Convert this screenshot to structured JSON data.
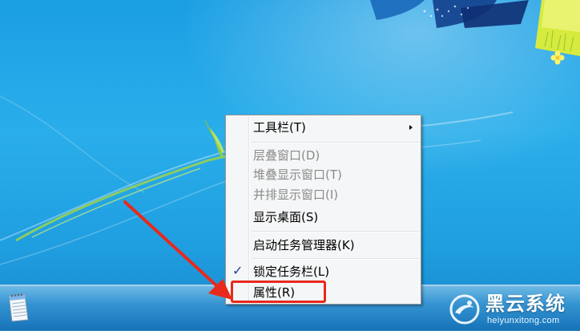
{
  "context_menu": {
    "items": [
      {
        "label": "工具栏(T)",
        "enabled": true,
        "submenu": true
      },
      {
        "label": "层叠窗口(D)",
        "enabled": false
      },
      {
        "label": "堆叠显示窗口(T)",
        "enabled": false
      },
      {
        "label": "并排显示窗口(I)",
        "enabled": false
      },
      {
        "label": "显示桌面(S)",
        "enabled": true
      },
      {
        "label": "启动任务管理器(K)",
        "enabled": true
      },
      {
        "label": "锁定任务栏(L)",
        "enabled": true,
        "checked": true
      },
      {
        "label": "属性(R)",
        "enabled": true,
        "highlighted": true
      }
    ],
    "check_glyph": "✓"
  },
  "watermark": {
    "title": "黑云系统",
    "subtitle": "heiyunxitong.com"
  },
  "colors": {
    "desktop_blue": "#1f9ee0",
    "highlight_red": "#e8291c",
    "check_blue": "#1a3fa6",
    "disabled_text": "#8a8a8a"
  },
  "icons": {
    "taskbar_app": "notepad-icon",
    "submenu": "chevron-right-icon",
    "check": "checkmark-icon"
  }
}
